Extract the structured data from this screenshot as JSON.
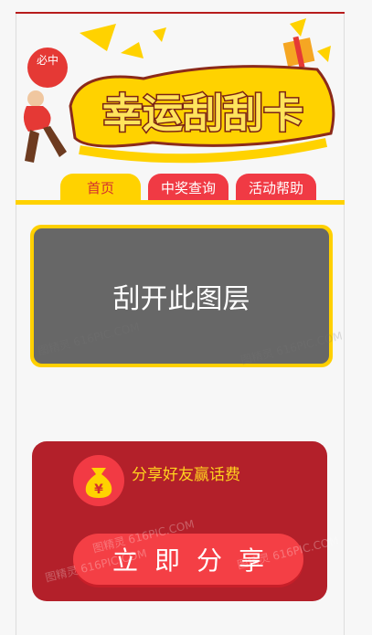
{
  "banner": {
    "title": "幸运刮刮卡",
    "badge": "必中"
  },
  "tabs": [
    {
      "label": "首页",
      "active": true
    },
    {
      "label": "中奖查询",
      "active": false
    },
    {
      "label": "活动帮助",
      "active": false
    }
  ],
  "scratch": {
    "label": "刮开此图层"
  },
  "share": {
    "promo_text": "分享好友赢话费",
    "button_label": "立即分享",
    "bag_symbol": "¥"
  },
  "watermark": "图精灵 616PIC.COM",
  "colors": {
    "accent_red": "#f03a44",
    "dark_red": "#b3202a",
    "yellow": "#ffd200",
    "scratch_gray": "#676767"
  }
}
